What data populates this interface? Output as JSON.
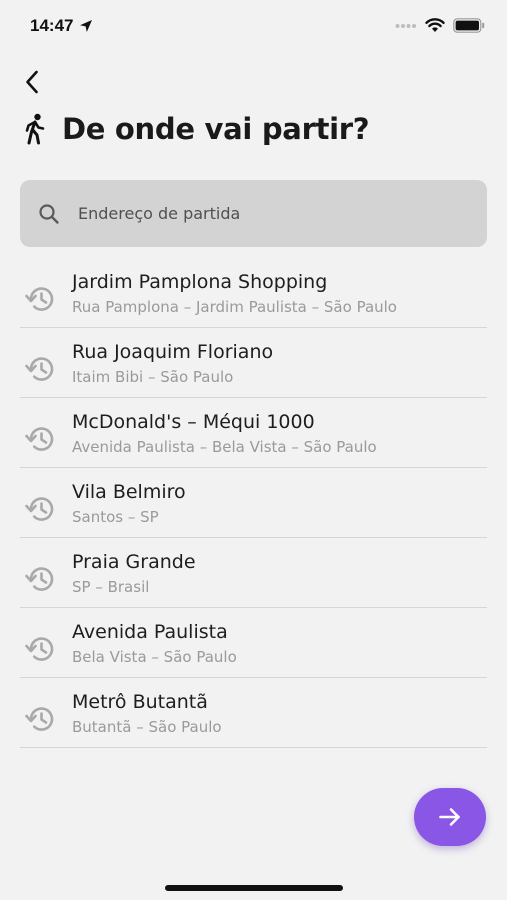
{
  "status_bar": {
    "time": "14:47"
  },
  "header": {
    "title": "De onde vai partir?"
  },
  "search": {
    "placeholder": "Endereço de partida",
    "value": ""
  },
  "recent_places": [
    {
      "title": "Jardim Pamplona Shopping",
      "subtitle": "Rua Pamplona – Jardim Paulista – São Paulo"
    },
    {
      "title": "Rua Joaquim Floriano",
      "subtitle": "Itaim Bibi – São Paulo"
    },
    {
      "title": "McDonald's – Méqui 1000",
      "subtitle": "Avenida Paulista – Bela Vista – São Paulo"
    },
    {
      "title": "Vila Belmiro",
      "subtitle": "Santos – SP"
    },
    {
      "title": "Praia Grande",
      "subtitle": "SP – Brasil"
    },
    {
      "title": "Avenida Paulista",
      "subtitle": "Bela Vista – São Paulo"
    },
    {
      "title": "Metrô Butantã",
      "subtitle": "Butantã – São Paulo"
    }
  ],
  "icons": {
    "back": "chevron-left-icon",
    "walk": "person-walking-icon",
    "search": "search-icon",
    "history": "history-icon",
    "next": "arrow-right-icon",
    "location": "location-arrow-icon",
    "wifi": "wifi-icon",
    "battery": "battery-icon",
    "signal": "cellular-signal-icon"
  },
  "colors": {
    "accent": "#8a56e6",
    "background": "#f2f2f2",
    "search_background": "#d3d3d3",
    "subtitle": "#9a9a9a"
  }
}
